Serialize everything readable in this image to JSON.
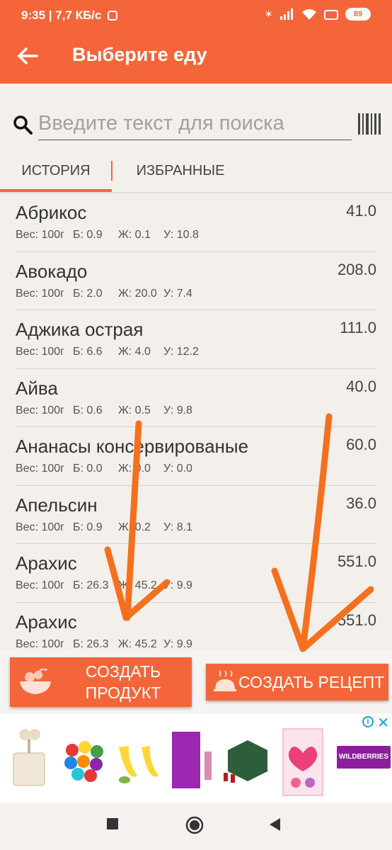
{
  "status_bar": {
    "time_speed": "9:35 | 7,7 КБ/с",
    "battery": "89"
  },
  "app_bar": {
    "title": "Выберите еду",
    "back_icon": "arrow-back-icon"
  },
  "search": {
    "placeholder": "Введите текст для поиска",
    "value": "",
    "icon": "search-icon",
    "barcode_icon": "barcode-icon"
  },
  "tabs": [
    {
      "label": "ИСТОРИЯ",
      "active": true
    },
    {
      "label": "ИЗБРАННЫЕ",
      "active": false
    }
  ],
  "foods": [
    {
      "name": "Абрикос",
      "kcal": "41.0",
      "weight": "Вес: 100г",
      "protein": "Б: 0.9",
      "fat": "Ж: 0.1",
      "carbs": "У: 10.8"
    },
    {
      "name": "Авокадо",
      "kcal": "208.0",
      "weight": "Вес: 100г",
      "protein": "Б: 2.0",
      "fat": "Ж: 20.0",
      "carbs": "У: 7.4"
    },
    {
      "name": "Аджика острая",
      "kcal": "111.0",
      "weight": "Вес: 100г",
      "protein": "Б: 6.6",
      "fat": "Ж: 4.0",
      "carbs": "У: 12.2"
    },
    {
      "name": "Айва",
      "kcal": "40.0",
      "weight": "Вес: 100г",
      "protein": "Б: 0.6",
      "fat": "Ж: 0.5",
      "carbs": "У: 9.8"
    },
    {
      "name": "Ананасы консервированые",
      "kcal": "60.0",
      "weight": "Вес: 100г",
      "protein": "Б: 0.0",
      "fat": "Ж: 0.0",
      "carbs": "У: 0.0"
    },
    {
      "name": "Апельсин",
      "kcal": "36.0",
      "weight": "Вес: 100г",
      "protein": "Б: 0.9",
      "fat": "Ж: 0.2",
      "carbs": "У: 8.1"
    },
    {
      "name": "Арахис",
      "kcal": "551.0",
      "weight": "Вес: 100г",
      "protein": "Б: 26.3",
      "fat": "Ж: 45.2",
      "carbs": "У: 9.9"
    },
    {
      "name": "Арахис",
      "kcal": "551.0",
      "weight": "Вес: 100г",
      "protein": "Б: 26.3",
      "fat": "Ж: 45.2",
      "carbs": "У: 9.9"
    }
  ],
  "buttons": {
    "create_product": "СОЗДАТЬ\nПРОДУКТ",
    "create_recipe": "СОЗДАТЬ РЕЦЕПТ"
  },
  "ad": {
    "brand": "WILDBERRIES",
    "info_icon": "info-icon",
    "close_icon": "close-icon"
  },
  "colors": {
    "accent": "#f4663a",
    "background": "#f3efea",
    "annotation": "#f4701f"
  }
}
